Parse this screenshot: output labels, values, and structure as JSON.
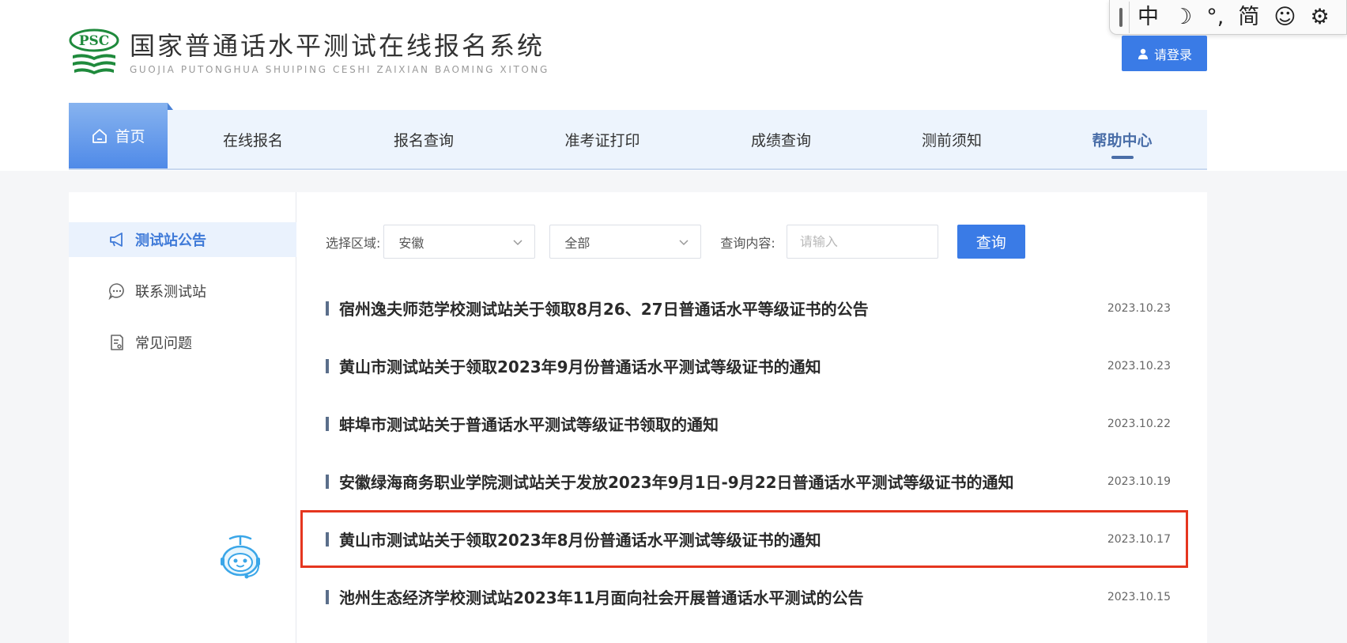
{
  "header": {
    "logo_text": "PSC",
    "title": "国家普通话水平测试在线报名系统",
    "subtitle": "GUOJIA PUTONGHUA SHUIPING CESHI ZAIXIAN BAOMING XITONG",
    "login_label": "请登录"
  },
  "ime": {
    "items": [
      "中",
      "☽",
      "°,",
      "简",
      "☺",
      "⚙"
    ]
  },
  "nav": {
    "home": "首页",
    "items": [
      "在线报名",
      "报名查询",
      "准考证打印",
      "成绩查询",
      "测前须知",
      "帮助中心"
    ],
    "active": "帮助中心"
  },
  "sidebar": {
    "items": [
      {
        "label": "测试站公告",
        "icon": "megaphone-icon",
        "active": true
      },
      {
        "label": "联系测试站",
        "icon": "chat-icon",
        "active": false
      },
      {
        "label": "常见问题",
        "icon": "document-icon",
        "active": false
      }
    ]
  },
  "filters": {
    "region_label": "选择区域:",
    "region_value": "安徽",
    "type_value": "全部",
    "query_label": "查询内容:",
    "query_placeholder": "请输入",
    "search_label": "查询"
  },
  "notices": [
    {
      "title": "宿州逸夫师范学校测试站关于领取8月26、27日普通话水平等级证书的公告",
      "date": "2023.10.23"
    },
    {
      "title": "黄山市测试站关于领取2023年9月份普通话水平测试等级证书的通知",
      "date": "2023.10.23"
    },
    {
      "title": "蚌埠市测试站关于普通话水平测试等级证书领取的通知",
      "date": "2023.10.22"
    },
    {
      "title": "安徽绿海商务职业学院测试站关于发放2023年9月1日-9月22日普通话水平测试等级证书的通知",
      "date": "2023.10.19"
    },
    {
      "title": "黄山市测试站关于领取2023年8月份普通话水平测试等级证书的通知",
      "date": "2023.10.17",
      "highlighted": true
    },
    {
      "title": "池州生态经济学校测试站2023年11月面向社会开展普通话水平测试的公告",
      "date": "2023.10.15"
    }
  ],
  "colors": {
    "accent": "#3a7be6",
    "nav_bg": "#edf4fd",
    "highlight": "#e5361f",
    "logo_green": "#1f8a3c"
  }
}
